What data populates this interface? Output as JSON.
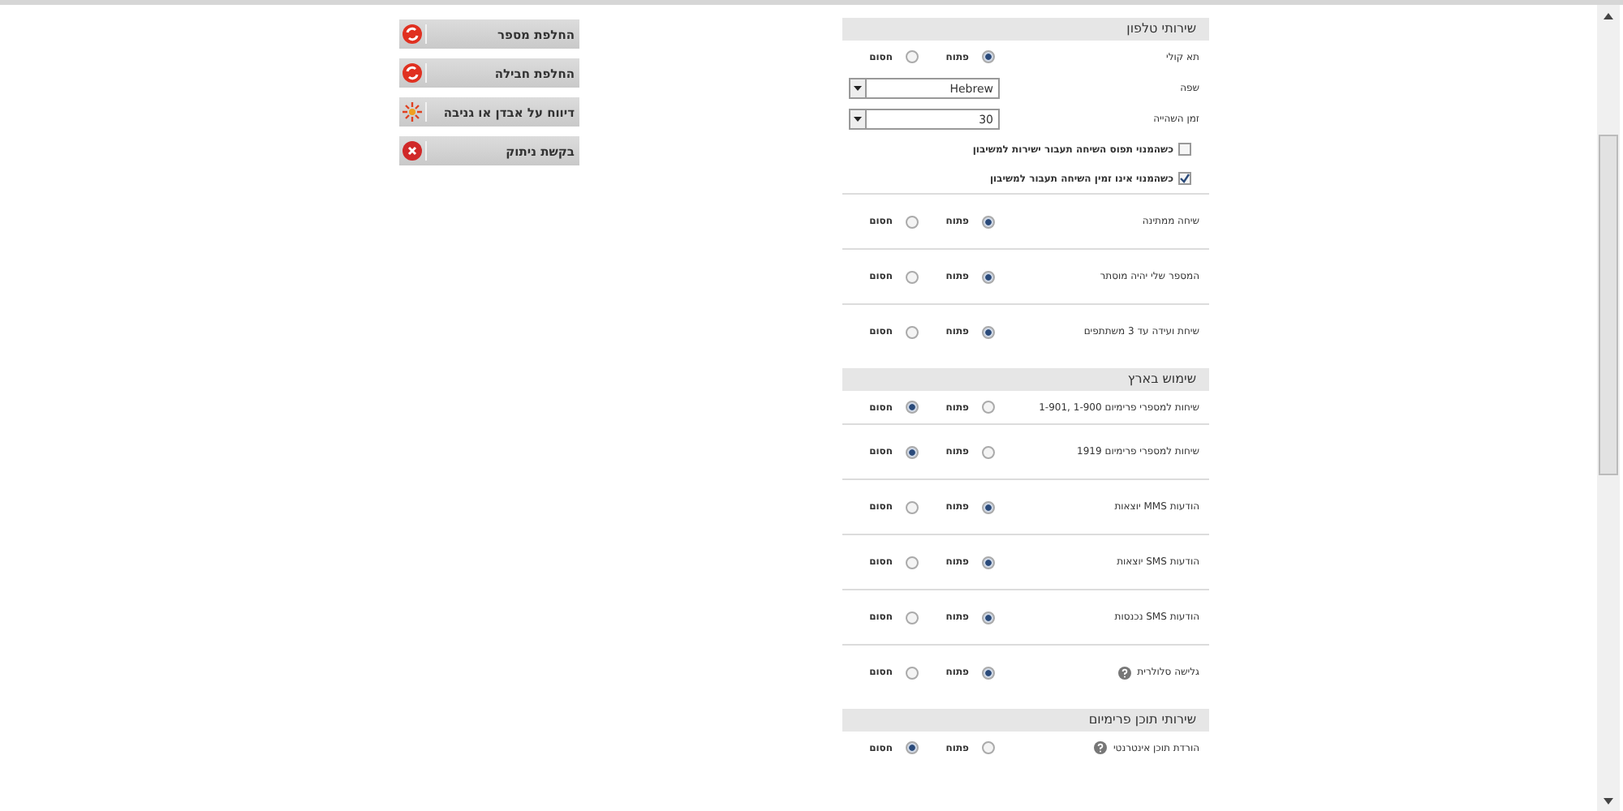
{
  "side_buttons": [
    {
      "label": "החלפת מספר",
      "kind": "swap"
    },
    {
      "label": "החלפת חבילה",
      "kind": "swap"
    },
    {
      "label": "דיווח על אבדן או גניבה",
      "kind": "alert"
    },
    {
      "label": "בקשת ניתוק",
      "kind": "cancel"
    }
  ],
  "sections": [
    {
      "title": "שירותי טלפון",
      "rows": [
        {
          "kind": "radio",
          "label": "תא קולי",
          "options": [
            {
              "label": "פתוח",
              "selected": true
            },
            {
              "label": "חסום",
              "selected": false
            }
          ]
        },
        {
          "kind": "select",
          "label": "שפה",
          "value": "Hebrew"
        },
        {
          "kind": "select",
          "label": "זמן השהייה",
          "value": "30"
        },
        {
          "kind": "checkbox",
          "label": "כשהמנוי תפוס השיחה תעבור ישירות למשיבון",
          "checked": false
        },
        {
          "kind": "checkbox",
          "label": "כשהמנוי אינו זמין השיחה תעבור למשיבון",
          "checked": true
        },
        {
          "kind": "radio",
          "label": "שיחה ממתינה",
          "options": [
            {
              "label": "פתוח",
              "selected": true
            },
            {
              "label": "חסום",
              "selected": false
            }
          ]
        },
        {
          "kind": "radio",
          "label": "המספר שלי יהיה מוסתר",
          "options": [
            {
              "label": "פתוח",
              "selected": true
            },
            {
              "label": "חסום",
              "selected": false
            }
          ]
        },
        {
          "kind": "radio",
          "label": "שיחת ועידה עד 3 משתתפים",
          "options": [
            {
              "label": "פתוח",
              "selected": true
            },
            {
              "label": "חסום",
              "selected": false
            }
          ]
        }
      ]
    },
    {
      "title": "שימוש בארץ",
      "rows": [
        {
          "kind": "radio",
          "label": "שיחות למספרי פרימיום 1-900 ,1-901",
          "options": [
            {
              "label": "פתוח",
              "selected": false
            },
            {
              "label": "חסום",
              "selected": true
            }
          ]
        },
        {
          "kind": "radio",
          "label": "שיחות למספרי פרימיום 1919",
          "options": [
            {
              "label": "פתוח",
              "selected": false
            },
            {
              "label": "חסום",
              "selected": true
            }
          ]
        },
        {
          "kind": "radio",
          "label": "הודעות MMS יוצאות",
          "options": [
            {
              "label": "פתוח",
              "selected": true
            },
            {
              "label": "חסום",
              "selected": false
            }
          ]
        },
        {
          "kind": "radio",
          "label": "הודעות SMS יוצאות",
          "options": [
            {
              "label": "פתוח",
              "selected": true
            },
            {
              "label": "חסום",
              "selected": false
            }
          ]
        },
        {
          "kind": "radio",
          "label": "הודעות SMS נכנסות",
          "options": [
            {
              "label": "פתוח",
              "selected": true
            },
            {
              "label": "חסום",
              "selected": false
            }
          ]
        },
        {
          "kind": "radio",
          "label": "גלישה סלולרית",
          "help": true,
          "options": [
            {
              "label": "פתוח",
              "selected": true
            },
            {
              "label": "חסום",
              "selected": false
            }
          ]
        }
      ]
    },
    {
      "title": "שירותי תוכן פרימיום",
      "rows": [
        {
          "kind": "radio",
          "label": "הורדת תוכן אינטרנטי",
          "help": true,
          "options": [
            {
              "label": "פתוח",
              "selected": false
            },
            {
              "label": "חסום",
              "selected": true
            }
          ]
        }
      ]
    }
  ]
}
